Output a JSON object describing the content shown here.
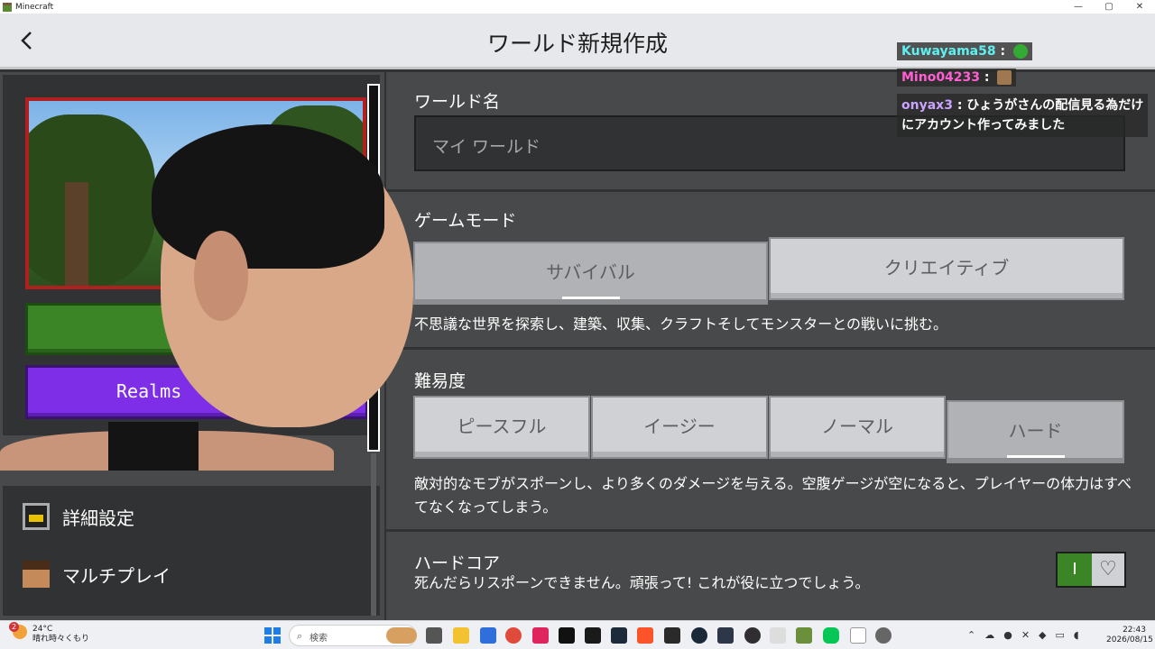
{
  "window": {
    "title": "Minecraft",
    "controls": [
      "—",
      "▢",
      "✕"
    ]
  },
  "header": {
    "title": "ワールド新規作成",
    "back_icon": "chevron-left-icon"
  },
  "left_panel": {
    "realms_label": "Realms",
    "items": [
      {
        "label": "詳細設定",
        "icon": "settings-icon"
      },
      {
        "label": "マルチプレイ",
        "icon": "multiplayer-icon"
      }
    ]
  },
  "world_name": {
    "label": "ワールド名",
    "value": "マイ ワールド"
  },
  "game_mode": {
    "label": "ゲームモード",
    "options": [
      "サバイバル",
      "クリエイティブ"
    ],
    "selected": "サバイバル",
    "description": "不思議な世界を探索し、建築、収集、クラフトそしてモンスターとの戦いに挑む。"
  },
  "difficulty": {
    "label": "難易度",
    "options": [
      "ピースフル",
      "イージー",
      "ノーマル",
      "ハード"
    ],
    "selected": "ハード",
    "description": "敵対的なモブがスポーンし、より多くのダメージを与える。空腹ゲージが空になると、プレイヤーの体力はすべてなくなってしまう。"
  },
  "hardcore": {
    "label": "ハードコア",
    "description": "死んだらリスポーンできません。頑張って! これが役に立つでしょう。",
    "toggle_on_text": "I",
    "enabled": true,
    "knob_icon": "heart-icon"
  },
  "chat": [
    {
      "user": "Kuwayama58",
      "sep": ":",
      "message": "",
      "color": "#5ff0f0"
    },
    {
      "user": "Mino04233",
      "sep": ":",
      "message": "",
      "color": "#ff5fd2"
    },
    {
      "user": "onyax3",
      "sep": ":",
      "message": "ひょうがさんの配信見る為だけ",
      "message2": "にアカウント作ってみました",
      "color": "#c9a4ff"
    }
  ],
  "taskbar": {
    "weather_temp": "24°C",
    "weather_text": "晴れ時々くもり",
    "weather_badge": "2",
    "search_placeholder": "検索",
    "time": "22:43",
    "date": "2026/08/15"
  },
  "colors": {
    "accent_green": "#3c8527",
    "realms_purple": "#7e2ee6",
    "selection_border": "#b11f1f"
  }
}
